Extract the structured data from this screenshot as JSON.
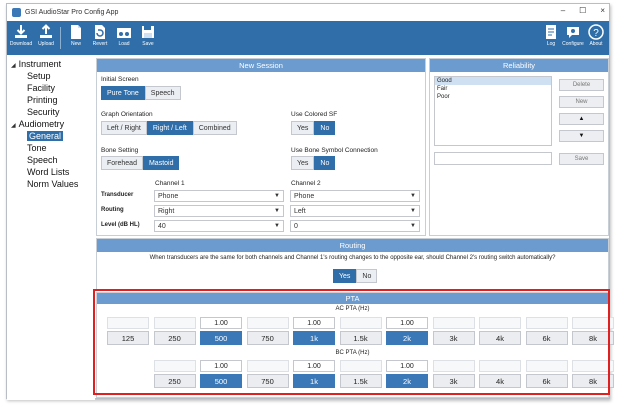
{
  "window": {
    "title": "GSI AudioStar Pro Config App",
    "controls": [
      "–",
      "☐",
      "×"
    ]
  },
  "toolbar": {
    "left_buttons": [
      {
        "label": "Download",
        "icon": "download-icon"
      },
      {
        "label": "Upload",
        "icon": "upload-icon"
      },
      {
        "label": "New",
        "icon": "new-file-icon"
      },
      {
        "label": "Revert",
        "icon": "revert-icon"
      },
      {
        "label": "Load",
        "icon": "load-icon"
      },
      {
        "label": "Save",
        "icon": "save-icon"
      }
    ],
    "right_buttons": [
      {
        "label": "Log",
        "icon": "log-icon"
      },
      {
        "label": "Configure",
        "icon": "configure-icon"
      },
      {
        "label": "About",
        "icon": "help-icon"
      }
    ]
  },
  "nav": {
    "groups": [
      {
        "label": "Instrument",
        "items": [
          "Setup",
          "Facility",
          "Printing",
          "Security"
        ]
      },
      {
        "label": "Audiometry",
        "items": [
          "General",
          "Tone",
          "Speech",
          "Word Lists",
          "Norm Values"
        ]
      }
    ],
    "selected": "General"
  },
  "session": {
    "title": "New Session",
    "initial_screen": {
      "label": "Initial Screen",
      "options": [
        "Pure Tone",
        "Speech"
      ],
      "selected": "Pure Tone"
    },
    "graph_orientation": {
      "label": "Graph Orientation",
      "options": [
        "Left / Right",
        "Right / Left",
        "Combined"
      ],
      "selected": "Right / Left"
    },
    "use_colored_sf": {
      "label": "Use Colored SF",
      "options": [
        "Yes",
        "No"
      ],
      "selected": "No"
    },
    "bone_setting": {
      "label": "Bone Setting",
      "options": [
        "Forehead",
        "Mastoid"
      ],
      "selected": "Mastoid"
    },
    "use_bone_symbol": {
      "label": "Use Bone Symbol Connection",
      "options": [
        "Yes",
        "No"
      ],
      "selected": "No"
    },
    "channel1_label": "Channel 1",
    "channel2_label": "Channel 2",
    "rows": [
      {
        "label": "Transducer",
        "ch1": "Phone",
        "ch2": "Phone"
      },
      {
        "label": "Routing",
        "ch1": "Right",
        "ch2": "Left"
      },
      {
        "label": "Level (dB HL)",
        "ch1": "40",
        "ch2": "0"
      }
    ]
  },
  "reliability": {
    "title": "Reliability",
    "items": [
      "Good",
      "Fair",
      "Poor"
    ],
    "selected": "Good",
    "buttons": {
      "delete": "Delete",
      "new": "New",
      "up": "▲",
      "down": "▼",
      "save": "Save"
    }
  },
  "routing": {
    "title": "Routing",
    "question": "When transducers are the same for both channels and Channel 1's routing changes to the opposite ear, should Channel 2's routing switch automatically?",
    "options": [
      "Yes",
      "No"
    ],
    "selected": "Yes"
  },
  "pta": {
    "title": "PTA",
    "ac": {
      "label": "AC PTA (Hz)",
      "frequencies": [
        "125",
        "250",
        "500",
        "750",
        "1k",
        "1.5k",
        "2k",
        "3k",
        "4k",
        "6k",
        "8k"
      ],
      "selected": [
        "500",
        "1k",
        "2k"
      ],
      "weights": {
        "500": "1.00",
        "1k": "1.00",
        "2k": "1.00"
      }
    },
    "bc": {
      "label": "BC PTA (Hz)",
      "frequencies": [
        "250",
        "500",
        "750",
        "1k",
        "1.5k",
        "2k",
        "3k",
        "4k",
        "6k",
        "8k"
      ],
      "selected": [
        "500",
        "1k",
        "2k"
      ],
      "weights": {
        "500": "1.00",
        "1k": "1.00",
        "2k": "1.00"
      }
    }
  },
  "colors": {
    "accent": "#2f6ea9",
    "panel_header": "#6b9bcf",
    "highlight": "#e02020"
  }
}
